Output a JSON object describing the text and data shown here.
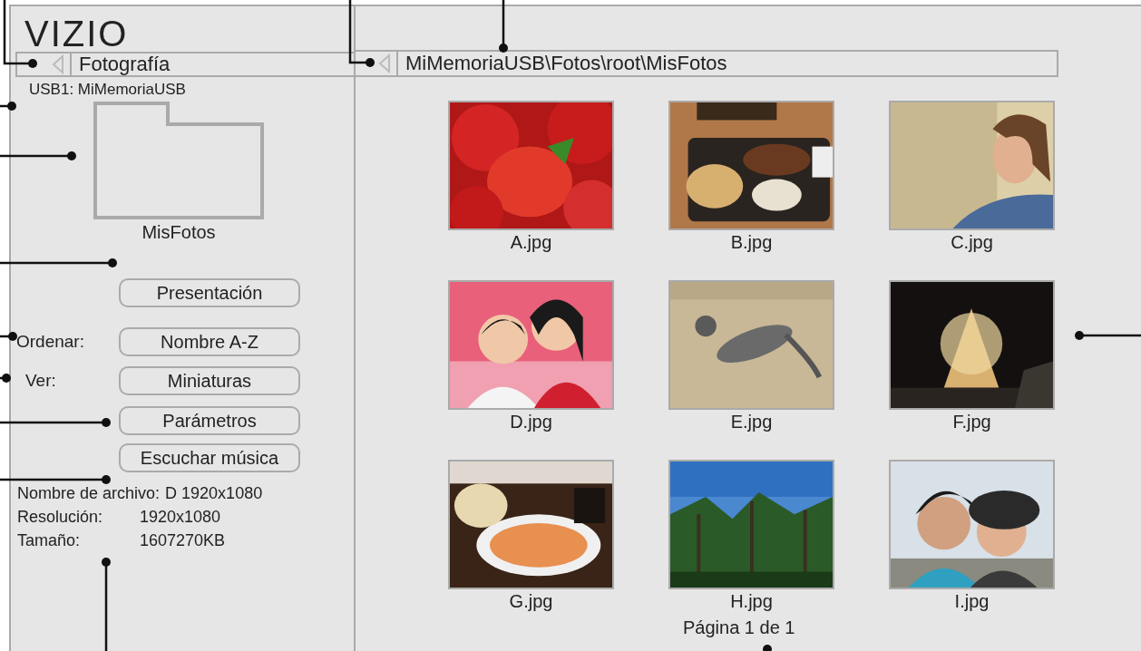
{
  "logo": "VIZIO",
  "left_header": {
    "title": "Fotografía"
  },
  "path_bar": {
    "path": "MiMemoriaUSB\\Fotos\\root\\MisFotos"
  },
  "source": "USB1: MiMemoriaUSB",
  "folder": {
    "name": "MisFotos"
  },
  "controls": [
    {
      "kind": "button",
      "label": "Presentación"
    },
    {
      "kind": "option",
      "label": "Ordenar:",
      "value": "Nombre A-Z"
    },
    {
      "kind": "option",
      "label": "Ver:",
      "value": "Miniaturas"
    },
    {
      "kind": "button",
      "label": "Parámetros"
    },
    {
      "kind": "button",
      "label": "Escuchar música"
    }
  ],
  "file_info": [
    {
      "label": "Nombre de archivo:",
      "value": "D 1920x1080"
    },
    {
      "label": "Resolución:",
      "value": "1920x1080"
    },
    {
      "label": "Tamaño:",
      "value": "1607270KB"
    }
  ],
  "thumbnails": [
    {
      "name": "A.jpg"
    },
    {
      "name": "B.jpg"
    },
    {
      "name": "C.jpg"
    },
    {
      "name": "D.jpg"
    },
    {
      "name": "E.jpg"
    },
    {
      "name": "F.jpg"
    },
    {
      "name": "G.jpg"
    },
    {
      "name": "H.jpg"
    },
    {
      "name": "I.jpg"
    }
  ],
  "page_indicator": "Página 1 de 1"
}
